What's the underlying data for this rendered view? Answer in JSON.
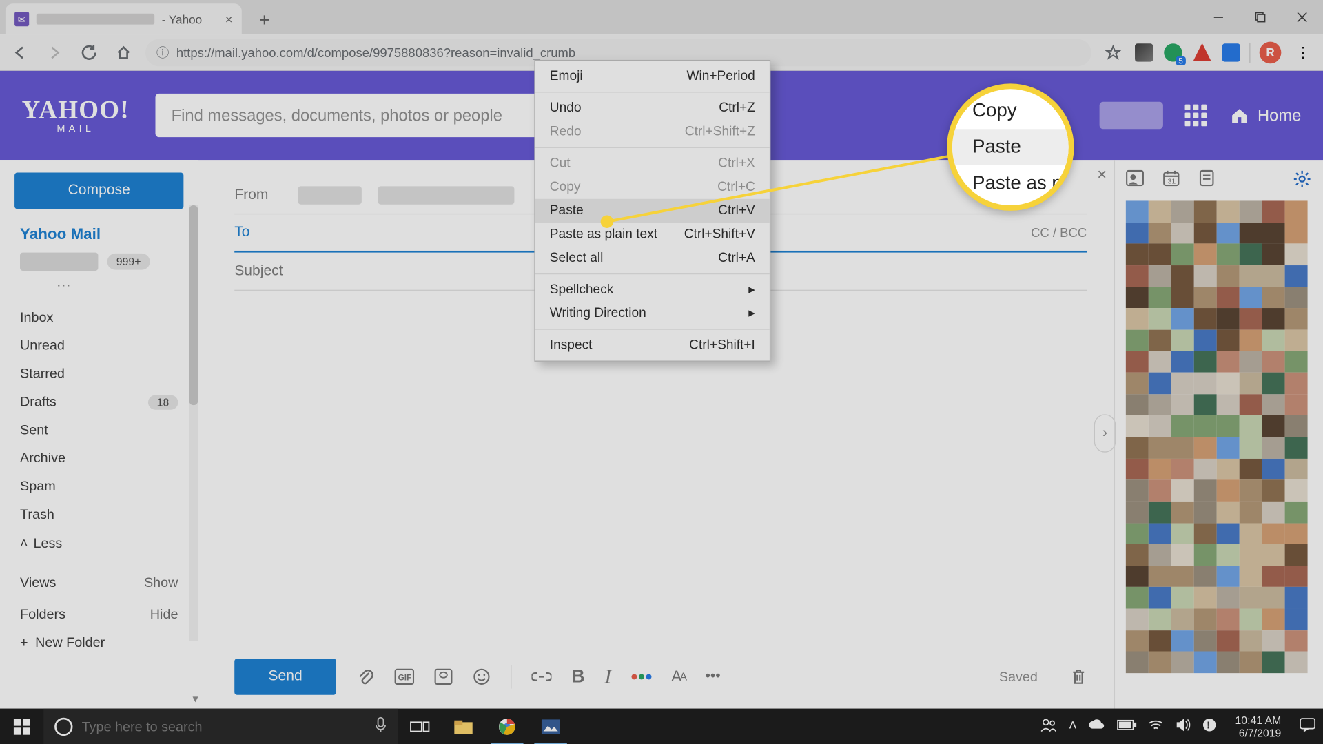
{
  "browser": {
    "tab_suffix": "- Yahoo",
    "url": "https://mail.yahoo.com/d/compose/9975880836?reason=invalid_crumb",
    "avatar_letter": "R",
    "ext_badge": "5"
  },
  "header": {
    "logo_top": "YAHOO!",
    "logo_bottom": "MAIL",
    "search_placeholder": "Find messages, documents, photos or people",
    "home": "Home"
  },
  "sidebar": {
    "compose": "Compose",
    "title": "Yahoo Mail",
    "badge": "999+",
    "folders": [
      {
        "label": "Inbox"
      },
      {
        "label": "Unread"
      },
      {
        "label": "Starred"
      },
      {
        "label": "Drafts",
        "count": "18"
      },
      {
        "label": "Sent"
      },
      {
        "label": "Archive"
      },
      {
        "label": "Spam"
      },
      {
        "label": "Trash"
      }
    ],
    "less": "Less",
    "views": "Views",
    "show": "Show",
    "folders_hdr": "Folders",
    "hide": "Hide",
    "new_folder": "New Folder"
  },
  "compose": {
    "from": "From",
    "to": "To",
    "ccbcc": "CC / BCC",
    "subject": "Subject",
    "send": "Send",
    "saved": "Saved"
  },
  "context_menu": {
    "groups": [
      [
        {
          "label": "Emoji",
          "shortcut": "Win+Period"
        }
      ],
      [
        {
          "label": "Undo",
          "shortcut": "Ctrl+Z"
        },
        {
          "label": "Redo",
          "shortcut": "Ctrl+Shift+Z",
          "disabled": true
        }
      ],
      [
        {
          "label": "Cut",
          "shortcut": "Ctrl+X",
          "disabled": true
        },
        {
          "label": "Copy",
          "shortcut": "Ctrl+C",
          "disabled": true
        },
        {
          "label": "Paste",
          "shortcut": "Ctrl+V",
          "highlight": true
        },
        {
          "label": "Paste as plain text",
          "shortcut": "Ctrl+Shift+V"
        },
        {
          "label": "Select all",
          "shortcut": "Ctrl+A"
        }
      ],
      [
        {
          "label": "Spellcheck",
          "submenu": true
        },
        {
          "label": "Writing Direction",
          "submenu": true
        }
      ],
      [
        {
          "label": "Inspect",
          "shortcut": "Ctrl+Shift+I"
        }
      ]
    ]
  },
  "callout": {
    "items": [
      {
        "label": "Copy"
      },
      {
        "label": "Paste",
        "highlight": true
      },
      {
        "label": "Paste as p"
      }
    ]
  },
  "taskbar": {
    "search_placeholder": "Type here to search",
    "time": "10:41 AM",
    "date": "6/7/2019"
  },
  "colors": {
    "yahoo_purple": "#5d4fd3",
    "yahoo_blue": "#0f79d0",
    "callout_yellow": "#f6d23a"
  }
}
